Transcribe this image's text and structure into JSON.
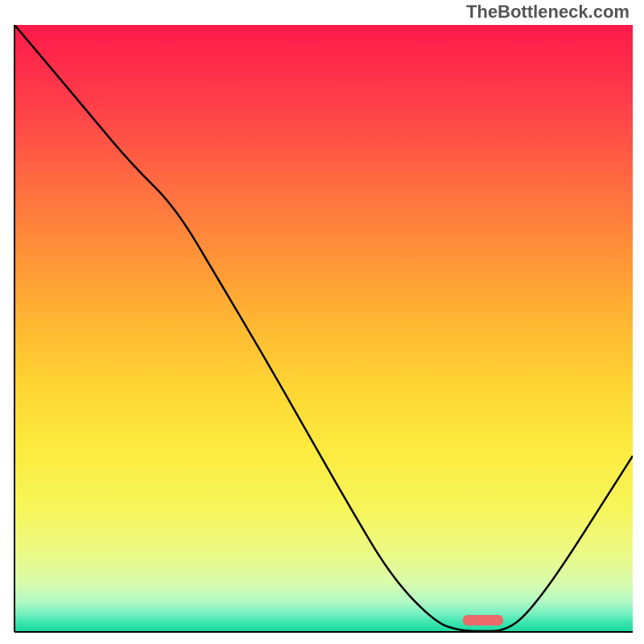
{
  "watermark": "TheBottleneck.com",
  "chart_data": {
    "type": "line",
    "title": "",
    "xlabel": "",
    "ylabel": "",
    "xlim": [
      0,
      100
    ],
    "ylim": [
      0,
      100
    ],
    "x": [
      0,
      5,
      12,
      19,
      26,
      33,
      40,
      47,
      54,
      61,
      68,
      72,
      76,
      79,
      82,
      86,
      90,
      95,
      100
    ],
    "values": [
      100,
      94,
      85.5,
      77,
      70,
      58,
      46,
      33.5,
      21,
      9,
      1.6,
      0.2,
      0.1,
      0.2,
      2,
      7,
      13,
      21,
      29
    ],
    "marker": {
      "x_start": 72.5,
      "x_end": 79,
      "y": 2,
      "color": "#ec6a6a"
    },
    "background_gradient": {
      "top": "#ff1a4a",
      "mid": "#ffd634",
      "bottom": "#18d99f"
    }
  }
}
